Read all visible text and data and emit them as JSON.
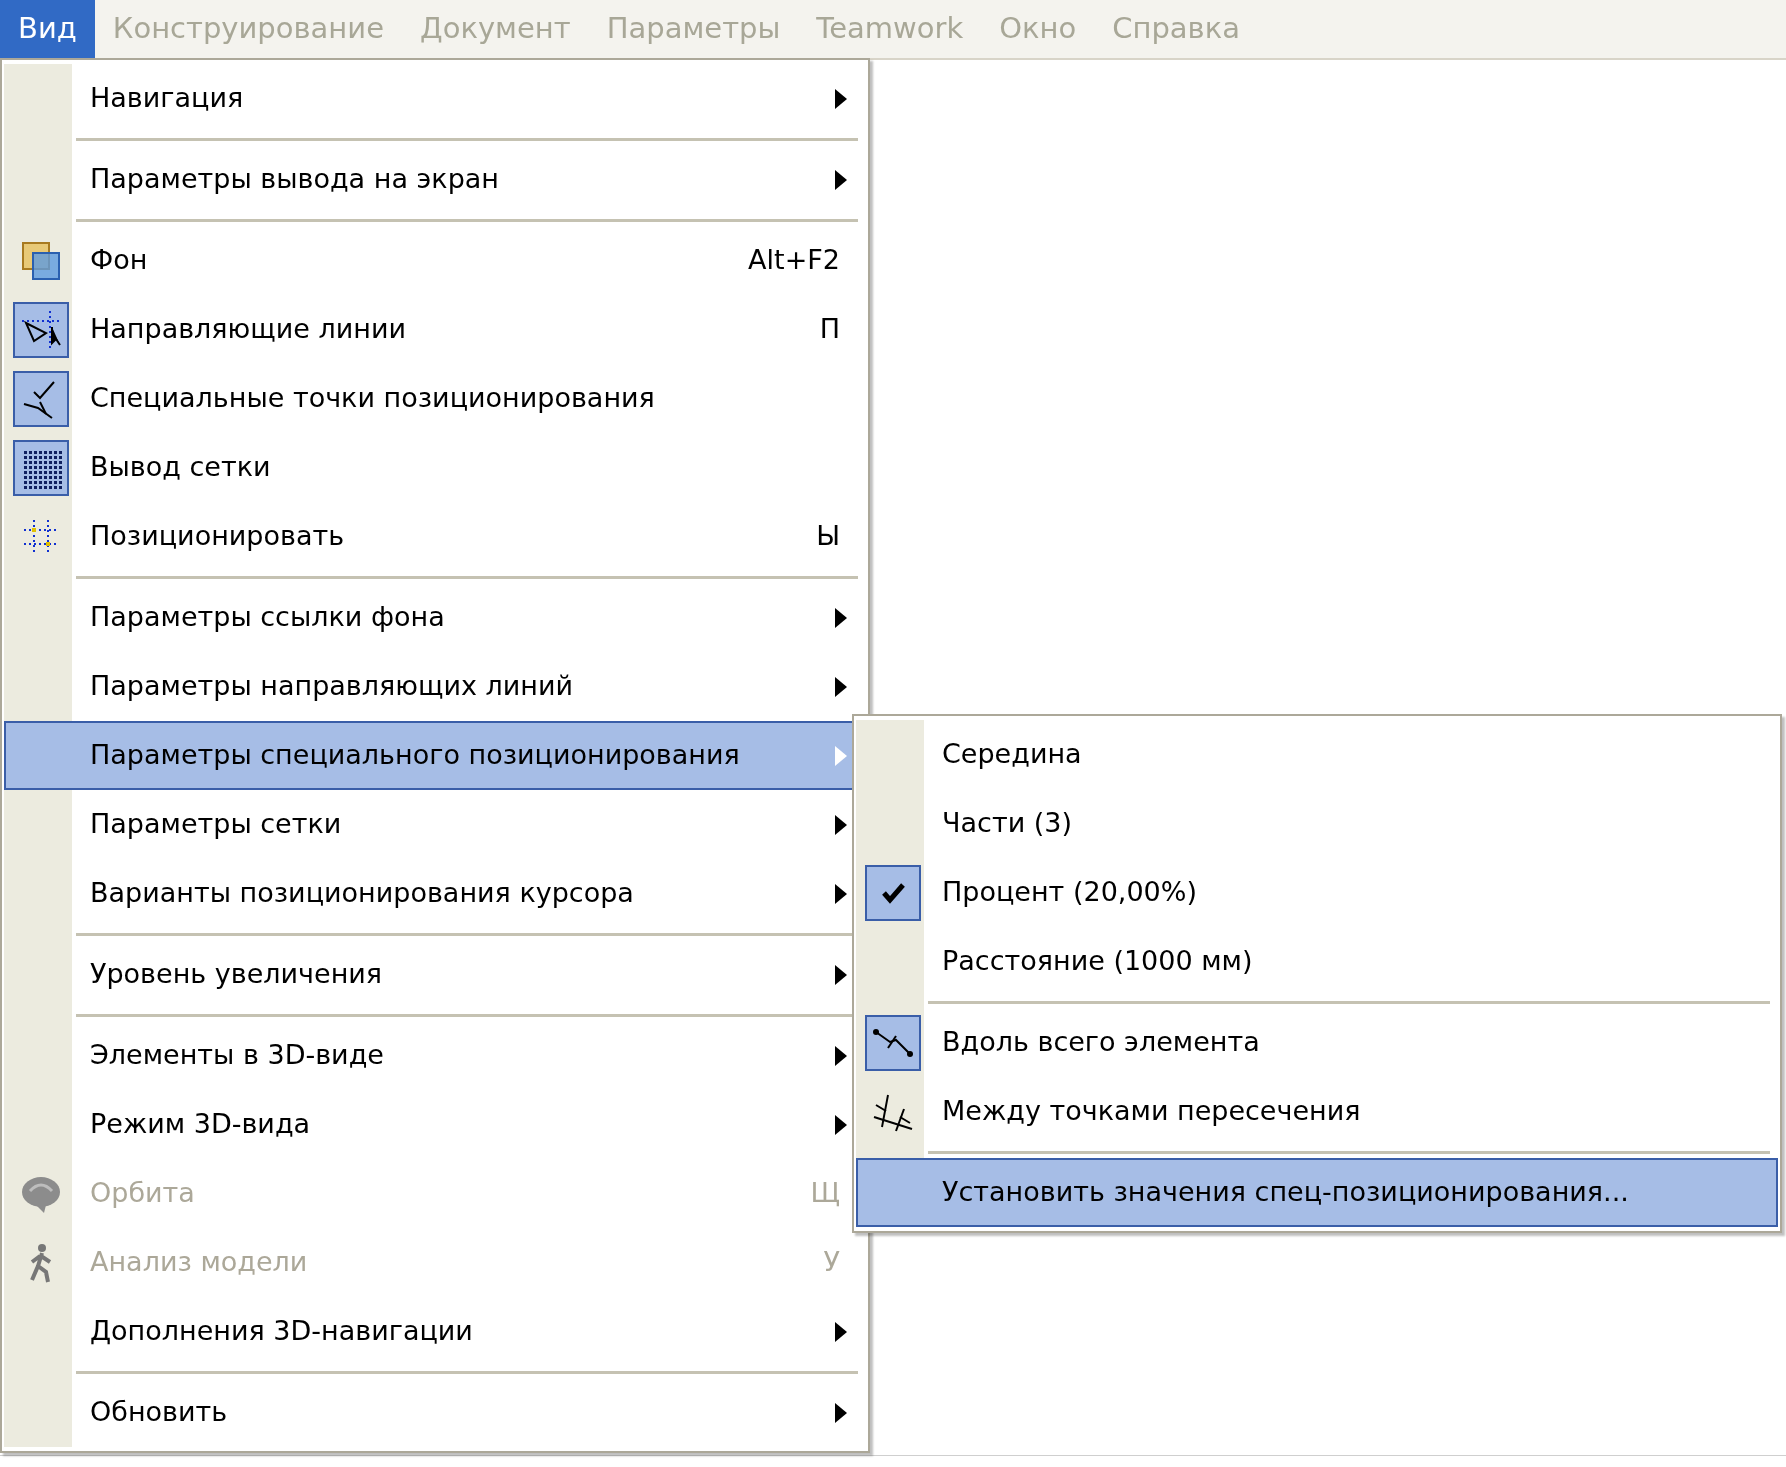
{
  "menubar": [
    {
      "label": "Вид",
      "selected": true
    },
    {
      "label": "Конструирование",
      "selected": false
    },
    {
      "label": "Документ",
      "selected": false
    },
    {
      "label": "Параметры",
      "selected": false
    },
    {
      "label": "Teamwork",
      "selected": false
    },
    {
      "label": "Окно",
      "selected": false
    },
    {
      "label": "Справка",
      "selected": false
    }
  ],
  "menu": [
    {
      "label": "Навигация",
      "kind": "submenu",
      "separator_after": true
    },
    {
      "label": "Параметры вывода на экран",
      "kind": "submenu",
      "separator_after": true
    },
    {
      "label": "Фон",
      "kind": "command",
      "checked": false,
      "shortcut": "Alt+F2"
    },
    {
      "label": "Направляющие линии",
      "kind": "command",
      "checked": true,
      "shortcut": "П"
    },
    {
      "label": "Специальные точки позиционирования",
      "kind": "command",
      "checked": true
    },
    {
      "label": "Вывод сетки",
      "kind": "command",
      "checked": true
    },
    {
      "label": "Позиционировать",
      "kind": "command",
      "checked": false,
      "shortcut": "Ы",
      "separator_after": true
    },
    {
      "label": "Параметры ссылки фона",
      "kind": "submenu"
    },
    {
      "label": "Параметры направляющих линий",
      "kind": "submenu"
    },
    {
      "label": "Параметры специального позиционирования",
      "kind": "submenu",
      "selected": true
    },
    {
      "label": "Параметры сетки",
      "kind": "submenu"
    },
    {
      "label": "Варианты позиционирования курсора",
      "kind": "submenu",
      "separator_after": true
    },
    {
      "label": "Уровень увеличения",
      "kind": "submenu",
      "separator_after": true
    },
    {
      "label": "Элементы в 3D-виде",
      "kind": "submenu"
    },
    {
      "label": "Режим 3D-вида",
      "kind": "submenu"
    },
    {
      "label": "Орбита",
      "kind": "command",
      "disabled": true,
      "shortcut": "Щ"
    },
    {
      "label": "Анализ модели",
      "kind": "command",
      "disabled": true,
      "shortcut": "У"
    },
    {
      "label": "Дополнения 3D-навигации",
      "kind": "submenu",
      "separator_after": true
    },
    {
      "label": "Обновить",
      "kind": "submenu"
    }
  ],
  "submenu": [
    {
      "label": "Середина",
      "kind": "option",
      "checked": false
    },
    {
      "label": "Части (3)",
      "kind": "option",
      "checked": false
    },
    {
      "label": "Процент (20,00%)",
      "kind": "option",
      "checked": true
    },
    {
      "label": "Расстояние (1000 мм)",
      "kind": "option",
      "checked": false,
      "separator_after": true
    },
    {
      "label": "Вдоль всего элемента",
      "kind": "command",
      "checked": true
    },
    {
      "label": "Между точками пересечения",
      "kind": "command",
      "checked": false,
      "separator_after": true
    },
    {
      "label": "Установить значения спец-позиционирования...",
      "kind": "command",
      "selected": true
    }
  ]
}
